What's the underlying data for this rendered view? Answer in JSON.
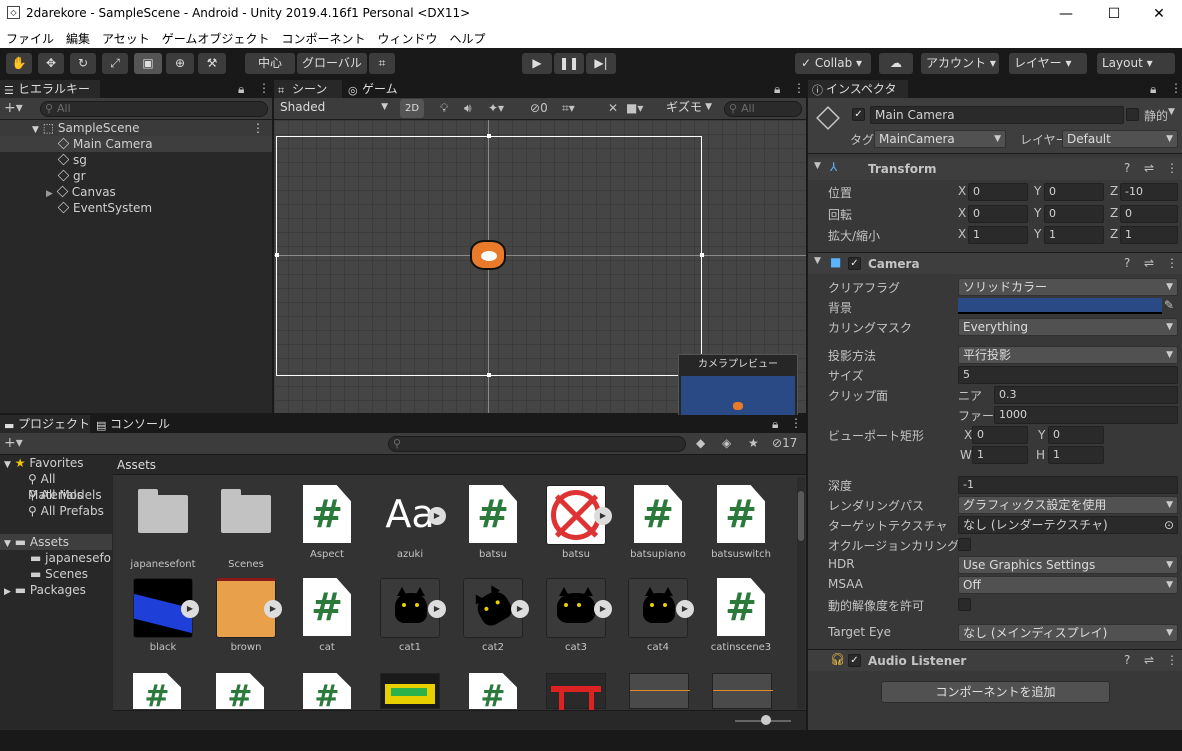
{
  "window": {
    "title": "2darekore - SampleScene - Android - Unity 2019.4.16f1 Personal <DX11>",
    "minimize": "—",
    "maximize": "☐",
    "close": "✕"
  },
  "menu": [
    "ファイル",
    "編集",
    "アセット",
    "ゲームオブジェクト",
    "コンポーネント",
    "ウィンドウ",
    "ヘルプ"
  ],
  "toolbar": {
    "pivot": "中心",
    "space": "グローバル",
    "collab": "Collab",
    "account": "アカウント",
    "layers": "レイヤー",
    "layout": "Layout"
  },
  "hierarchy": {
    "tab": "ヒエラルキー",
    "search_placeholder": "All",
    "scene": "SampleScene",
    "items": [
      "Main Camera",
      "sg",
      "gr",
      "Canvas",
      "EventSystem"
    ]
  },
  "scene_view": {
    "tab_scene": "シーン",
    "tab_game": "ゲーム",
    "shading": "Shaded",
    "mode_2d": "2D",
    "hidden_count": "0",
    "gizmos": "ギズモ",
    "search_placeholder": "All",
    "camera_preview": "カメラプレビュー"
  },
  "project": {
    "tab_project": "プロジェクト",
    "tab_console": "コンソール",
    "hidden_count": "17",
    "favorites": "Favorites",
    "fav_items": [
      "All Materials",
      "All Models",
      "All Prefabs"
    ],
    "assets_root": "Assets",
    "asset_folders": [
      "japanesefont",
      "Scenes"
    ],
    "packages": "Packages",
    "breadcrumb": "Assets",
    "row1": [
      "japanesefont",
      "Scenes",
      "Aspect",
      "azuki",
      "batsu",
      "batsu",
      "batsupiano",
      "batsuswitch"
    ],
    "row2": [
      "black",
      "brown",
      "cat",
      "cat1",
      "cat2",
      "cat3",
      "cat4",
      "catinscene3"
    ]
  },
  "inspector": {
    "tab": "インスペクター",
    "object_name": "Main Camera",
    "static": "静的",
    "tag_label": "タグ",
    "tag": "MainCamera",
    "layer_label": "レイヤー",
    "layer": "Default",
    "transform": {
      "title": "Transform",
      "position_label": "位置",
      "rotation_label": "回転",
      "scale_label": "拡大/縮小",
      "position": [
        "0",
        "0",
        "-10"
      ],
      "rotation": [
        "0",
        "0",
        "0"
      ],
      "scale": [
        "1",
        "1",
        "1"
      ],
      "axes": [
        "X",
        "Y",
        "Z"
      ]
    },
    "camera": {
      "title": "Camera",
      "clear_flags_label": "クリアフラグ",
      "clear_flags": "ソリッドカラー",
      "background_label": "背景",
      "background_color": "#2a4a86",
      "culling_mask_label": "カリングマスク",
      "culling_mask": "Everything",
      "projection_label": "投影方法",
      "projection": "平行投影",
      "size_label": "サイズ",
      "size": "5",
      "clip_label": "クリップ面",
      "near_label": "ニア",
      "near": "0.3",
      "far_label": "ファー",
      "far": "1000",
      "viewport_label": "ビューポート矩形",
      "vx": "0",
      "vy": "0",
      "vw": "1",
      "vh": "1",
      "depth_label": "深度",
      "depth": "-1",
      "rendering_path_label": "レンダリングパス",
      "rendering_path": "グラフィックス設定を使用",
      "target_texture_label": "ターゲットテクスチャ",
      "target_texture": "なし (レンダーテクスチャ)",
      "occlusion_label": "オクルージョンカリング",
      "hdr_label": "HDR",
      "hdr": "Use Graphics Settings",
      "msaa_label": "MSAA",
      "msaa": "Off",
      "dynamic_res_label": "動的解像度を許可",
      "target_eye_label": "Target Eye",
      "target_eye": "なし (メインディスプレイ)"
    },
    "audio_listener": {
      "title": "Audio Listener"
    },
    "add_component": "コンポーネントを追加"
  }
}
